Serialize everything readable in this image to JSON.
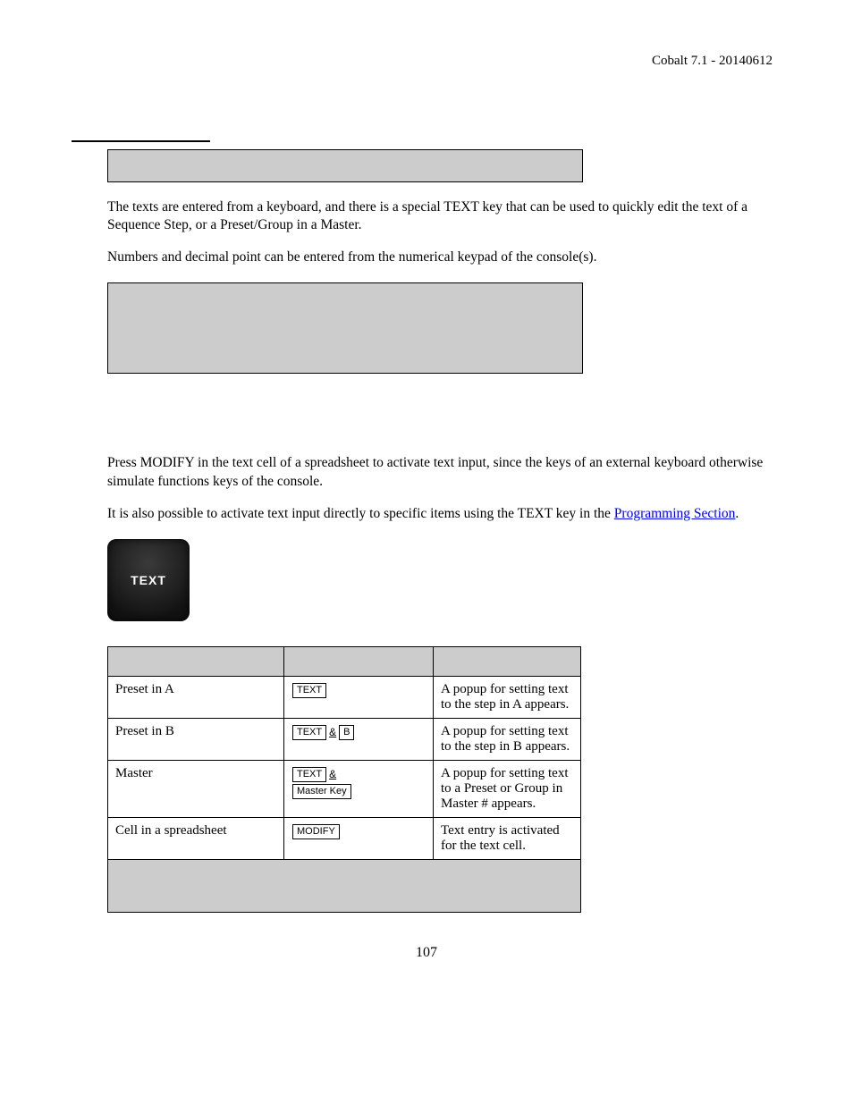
{
  "header": "Cobalt 7.1 - 20140612",
  "para1": "The texts are entered from a keyboard, and there is a special TEXT key that can be used to quickly edit the text of a Sequence Step, or a Preset/Group in a Master.",
  "para2": "Numbers and decimal point can be entered from the numerical keypad of the console(s).",
  "para3a": "Press MODIFY in the text cell of a spreadsheet to activate text input, since the keys of an external keyboard otherwise simulate functions keys of the console.",
  "para3b_pre": "It is also possible to activate text input directly to specific items using the TEXT key in the ",
  "para3b_link": "Programming Section",
  "para3b_post": ".",
  "text_key_label": "TEXT",
  "table": {
    "rows": [
      {
        "item": "Preset in A",
        "keys": [
          {
            "cap": "TEXT"
          }
        ],
        "result": "A popup for setting text to the step in A appears."
      },
      {
        "item": "Preset in B",
        "keys": [
          {
            "cap": "TEXT"
          },
          {
            "amp": "&"
          },
          {
            "cap": "B"
          }
        ],
        "result": "A popup for setting text to the step in B appears."
      },
      {
        "item": "Master",
        "keys": [
          {
            "cap": "TEXT"
          },
          {
            "amp": "&"
          },
          {
            "br": true
          },
          {
            "cap": "Master Key"
          }
        ],
        "result": "A popup for setting text to a Preset or Group in Master # appears."
      },
      {
        "item": "Cell in a spreadsheet",
        "keys": [
          {
            "cap": "MODIFY"
          }
        ],
        "result": "Text entry is activated for the text cell."
      }
    ]
  },
  "page_number": "107"
}
